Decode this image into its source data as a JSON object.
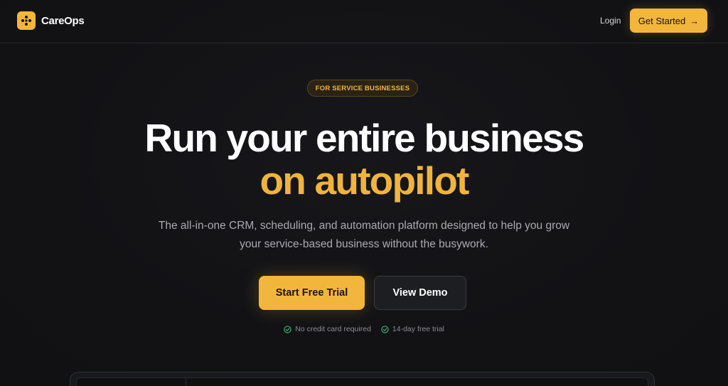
{
  "header": {
    "brand": "CareOps",
    "login_label": "Login",
    "cta_label": "Get Started",
    "cta_icon": "arrow-right-icon"
  },
  "hero": {
    "badge": "FOR SERVICE BUSINESSES",
    "headline_line1": "Run your entire business",
    "headline_line2": "on autopilot",
    "subtitle": "The all-in-one CRM, scheduling, and automation platform designed to help you grow your service-based business without the busywork.",
    "primary_button": "Start Free Trial",
    "secondary_button": "View Demo",
    "checks": [
      {
        "icon": "check-circle-icon",
        "label": "No credit card required"
      },
      {
        "icon": "check-circle-icon",
        "label": "14-day free trial"
      }
    ]
  },
  "colors": {
    "accent": "#f2b63c",
    "background": "#121215",
    "check": "#3fae73"
  }
}
